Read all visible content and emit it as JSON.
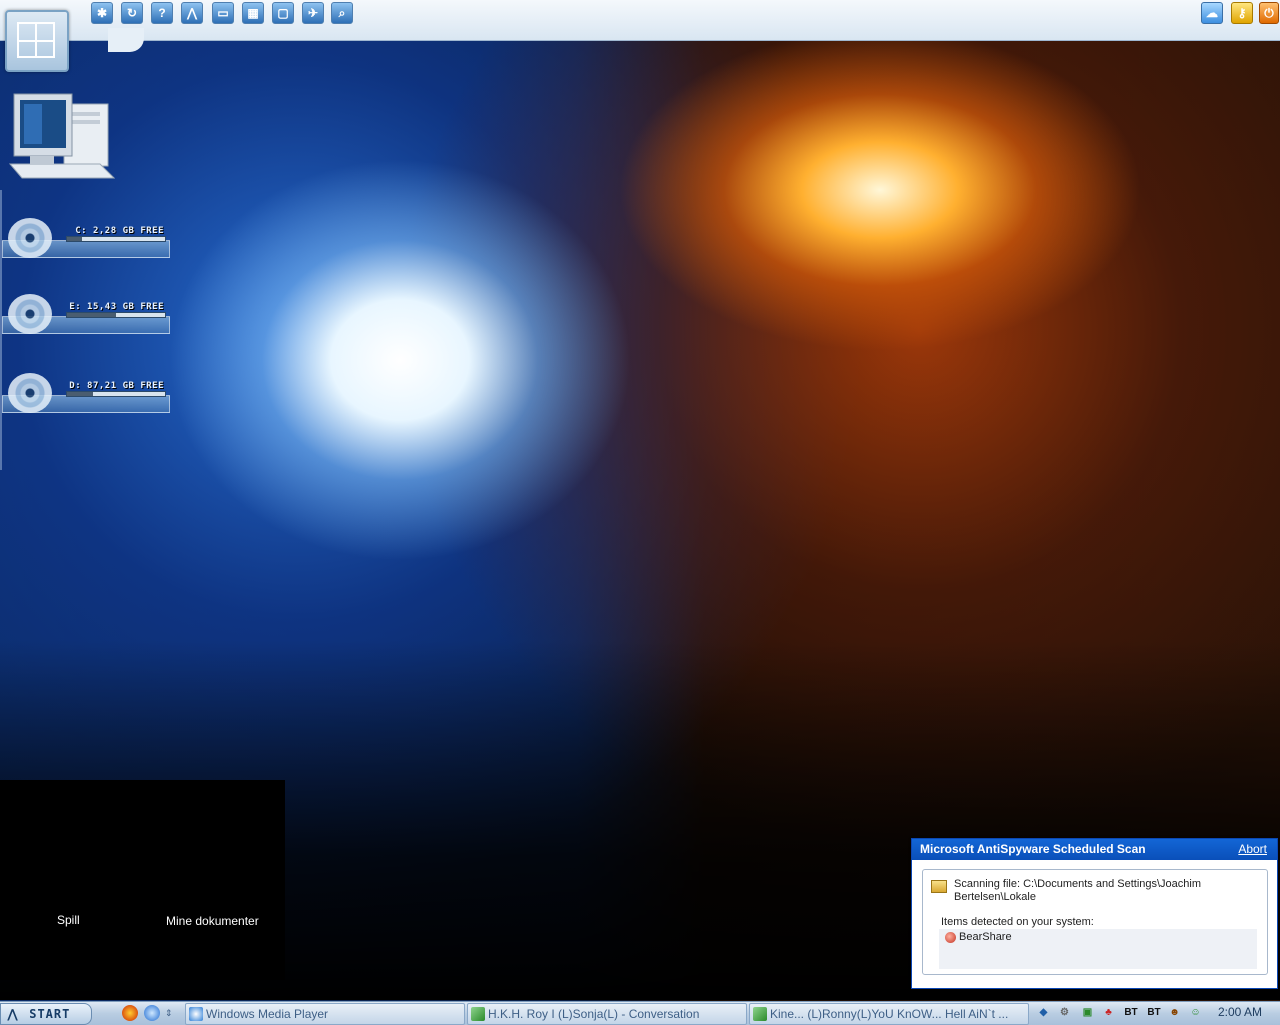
{
  "top_toolbar": {
    "icons": [
      "settings-icon",
      "refresh-icon",
      "help-icon",
      "tools-icon",
      "window-icon",
      "grid-icon",
      "monitor-icon",
      "run-icon",
      "search-icon"
    ],
    "right_icons": [
      "network-icon",
      "key-icon",
      "power-icon"
    ]
  },
  "desktop": {
    "drives": [
      {
        "label": "C: 2,28 GB FREE",
        "free_fraction": 0.15
      },
      {
        "label": "E: 15,43 GB FREE",
        "free_fraction": 0.5
      },
      {
        "label": "D: 87,21 GB FREE",
        "free_fraction": 0.27
      }
    ],
    "shortcuts": [
      {
        "label": "Spill"
      },
      {
        "label": "Mine dokumenter"
      }
    ]
  },
  "popup": {
    "title": "Microsoft AntiSpyware Scheduled Scan",
    "abort_label": "Abort",
    "scan_text": "Scanning file: C:\\Documents and Settings\\Joachim Bertelsen\\Lokale",
    "items_label": "Items detected on your system:",
    "items": [
      "BearShare"
    ]
  },
  "taskbar": {
    "start_label": "START",
    "tasks": [
      {
        "label": "Windows Media Player"
      },
      {
        "label": "H.K.H. Roy I (L)Sonja(L)  - Conversation"
      },
      {
        "label": "Kine... (L)Ronny(L)YoU KnOW... Hell AiN`t ..."
      }
    ],
    "tray": {
      "bt1": "BT",
      "bt2": "BT",
      "clock": "2:00 AM"
    }
  },
  "colors": {
    "popup_title_bg": "#0a4fb9",
    "taskbar_bg": "#b9cde2"
  }
}
